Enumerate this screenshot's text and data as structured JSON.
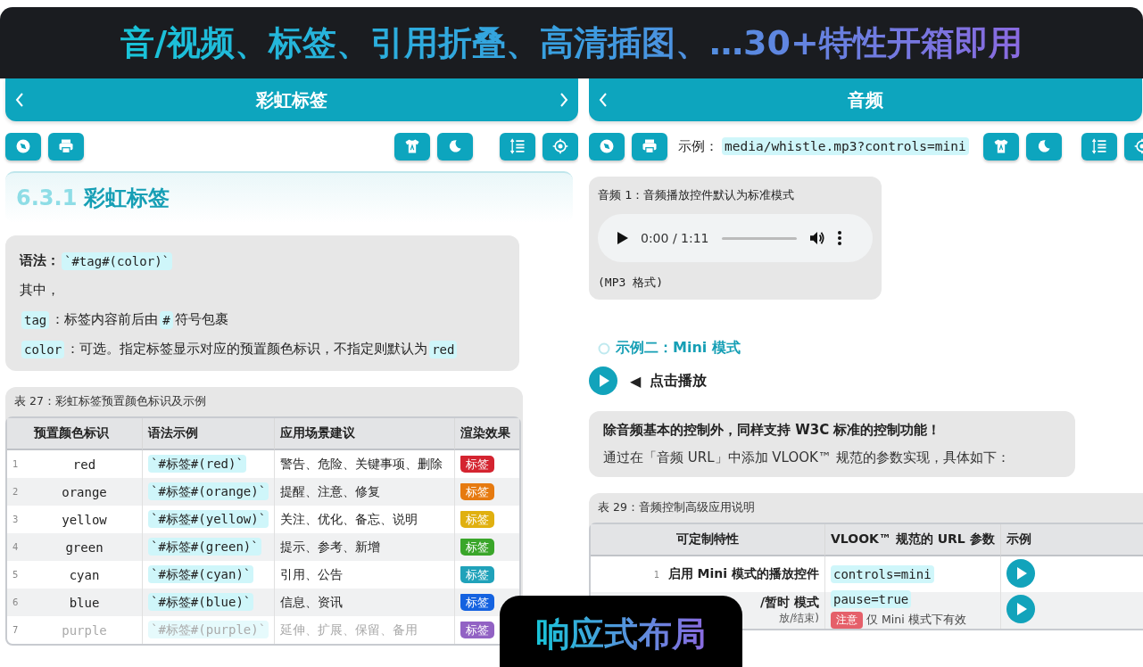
{
  "banner": {
    "title": "音/视频、标签、引用折叠、高清插图、…30+特性开箱即用"
  },
  "left_panel": {
    "nav": {
      "title": "彩虹标签",
      "prev_button": true,
      "next_button": true
    },
    "heading": {
      "number": "6.3.1",
      "text": "彩虹标签"
    },
    "syntax_lines": [
      [
        {
          "kind": "bold",
          "text": "语法："
        },
        {
          "kind": "code",
          "text": "`#tag#(color)`"
        }
      ],
      [
        {
          "kind": "text",
          "text": "其中，"
        }
      ],
      [
        {
          "kind": "code",
          "text": "tag"
        },
        {
          "kind": "text",
          "text": "：标签内容前后由"
        },
        {
          "kind": "code",
          "text": "#"
        },
        {
          "kind": "text",
          "text": "符号包裹"
        }
      ],
      [
        {
          "kind": "code",
          "text": "color"
        },
        {
          "kind": "text",
          "text": "：可选。指定标签显示对应的预置颜色标识，不指定则默认为"
        },
        {
          "kind": "code",
          "text": "red"
        }
      ]
    ],
    "table": {
      "caption": "表 27：彩虹标签预置颜色标识及示例",
      "columns": [
        "预置颜色标识",
        "语法示例",
        "应用场景建议",
        "渲染效果"
      ],
      "rows": [
        {
          "index": "1",
          "name": "red",
          "syntax": "`#标签#(red)`",
          "usage": "警告、危险、关键事项、删除",
          "tag": "标签",
          "color": "#d42430",
          "faded": false
        },
        {
          "index": "2",
          "name": "orange",
          "syntax": "`#标签#(orange)`",
          "usage": "提醒、注意、修复",
          "tag": "标签",
          "color": "#e67a10",
          "faded": false
        },
        {
          "index": "3",
          "name": "yellow",
          "syntax": "`#标签#(yellow)`",
          "usage": "关注、优化、备忘、说明",
          "tag": "标签",
          "color": "#e0b010",
          "faded": false
        },
        {
          "index": "4",
          "name": "green",
          "syntax": "`#标签#(green)`",
          "usage": "提示、参考、新增",
          "tag": "标签",
          "color": "#3aa62a",
          "faded": false
        },
        {
          "index": "5",
          "name": "cyan",
          "syntax": "`#标签#(cyan)`",
          "usage": "引用、公告",
          "tag": "标签",
          "color": "#20a2ba",
          "faded": false
        },
        {
          "index": "6",
          "name": "blue",
          "syntax": "`#标签#(blue)`",
          "usage": "信息、资讯",
          "tag": "标签",
          "color": "#1462e0",
          "faded": false
        },
        {
          "index": "7",
          "name": "purple",
          "syntax": "`#标签#(purple)`",
          "usage": "延伸、扩展、保留、备用",
          "tag": "标签",
          "color": "#9262c4",
          "faded": true
        }
      ]
    }
  },
  "right_panel": {
    "nav": {
      "title": "音频",
      "prev_button": true,
      "next_button": false
    },
    "example": {
      "label": "示例：",
      "code": "media/whistle.mp3?controls=mini"
    },
    "audio_card": {
      "caption": "音频 1：音频播放控件默认为标准模式",
      "time": "0:00 / 1:11",
      "format": "(MP3 格式)"
    },
    "section_title": "示例二：Mini 模式",
    "mini_player": {
      "arrow": "◀",
      "label": "点击播放"
    },
    "note": {
      "title": "除音频基本的控制外，同样支持 W3C 标准的控制功能！",
      "text": "通过在「音频 URL」中添加 VLOOK™ 规范的参数实现，具体如下："
    },
    "table": {
      "caption": "表 29：音频控制高级应用说明",
      "columns": [
        "可定制特性",
        "VLOOK™ 规范的 URL 参数",
        "示例"
      ],
      "rows": [
        {
          "index": "1",
          "feature": "启用 Mini 模式的播放控件",
          "feature_sub": null,
          "param": "controls=mini",
          "note": null
        },
        {
          "index": null,
          "feature": "/暂时 模式",
          "feature_sub": "放/结束)",
          "param": "pause=true",
          "note": {
            "badge": "注意",
            "text": "仅 Mini 模式下有效"
          }
        }
      ]
    }
  },
  "overlay_badge": {
    "text": "响应式布局"
  }
}
